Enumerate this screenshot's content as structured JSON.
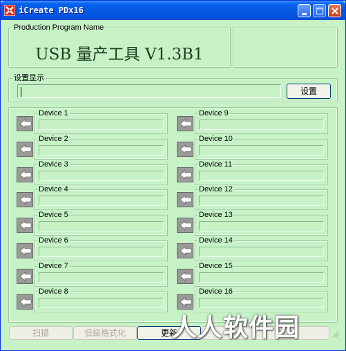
{
  "window": {
    "title": "iCreate PDx16",
    "controls": {
      "minimize": "minimize-icon",
      "maximize": "maximize-icon",
      "close": "close-icon"
    }
  },
  "program": {
    "legend": "Production Program Name",
    "name": "USB 量产工具 V1.3B1"
  },
  "settings": {
    "legend": "设置显示",
    "value": "",
    "button_label": "设置"
  },
  "devices": [
    {
      "label": "Device 1",
      "value": ""
    },
    {
      "label": "Device 2",
      "value": ""
    },
    {
      "label": "Device 3",
      "value": ""
    },
    {
      "label": "Device 4",
      "value": ""
    },
    {
      "label": "Device 5",
      "value": ""
    },
    {
      "label": "Device 6",
      "value": ""
    },
    {
      "label": "Device 7",
      "value": ""
    },
    {
      "label": "Device 8",
      "value": ""
    },
    {
      "label": "Device 9",
      "value": ""
    },
    {
      "label": "Device 10",
      "value": ""
    },
    {
      "label": "Device 11",
      "value": ""
    },
    {
      "label": "Device 12",
      "value": ""
    },
    {
      "label": "Device 13",
      "value": ""
    },
    {
      "label": "Device 14",
      "value": ""
    },
    {
      "label": "Device 15",
      "value": ""
    },
    {
      "label": "Device 16",
      "value": ""
    }
  ],
  "bottom_buttons": {
    "scan": "扫描",
    "low_format": "低级格式化",
    "update": "更新"
  },
  "watermark": "人人软件园",
  "colors": {
    "background": "#c6f2c6",
    "titlebar": "#0a64f0",
    "close": "#c8391b"
  }
}
